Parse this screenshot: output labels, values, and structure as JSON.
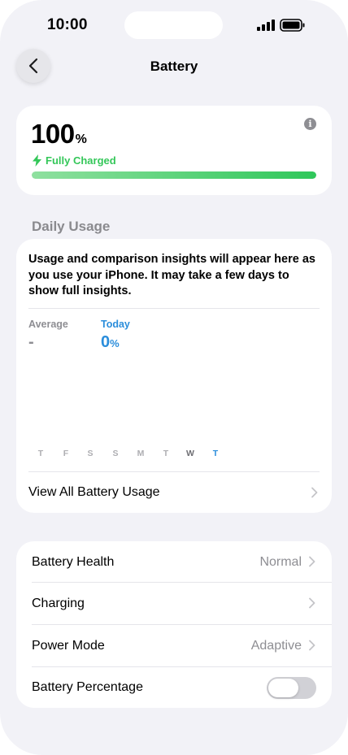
{
  "status_bar": {
    "time": "10:00"
  },
  "nav": {
    "title": "Battery"
  },
  "battery_level": {
    "percent": "100",
    "unit": "%",
    "state": "Fully Charged",
    "fill_fraction": 1.0
  },
  "daily_usage": {
    "header": "Daily Usage",
    "message": "Usage and comparison insights will appear here as you use your iPhone. It may take a few days to show full insights.",
    "average_label": "Average",
    "average_value": "-",
    "today_label": "Today",
    "today_value": "0",
    "today_unit": "%",
    "days": [
      "T",
      "F",
      "S",
      "S",
      "M",
      "T",
      "W",
      "T"
    ],
    "view_all_label": "View All Battery Usage"
  },
  "settings": {
    "rows": [
      {
        "label": "Battery Health",
        "value": "Normal"
      },
      {
        "label": "Charging",
        "value": ""
      },
      {
        "label": "Power Mode",
        "value": "Adaptive"
      },
      {
        "label": "Battery Percentage",
        "value": ""
      }
    ],
    "battery_percentage_enabled": false
  },
  "colors": {
    "accent_blue": "#2a8ddb",
    "charge_green": "#34c759",
    "background": "#f2f2f7"
  }
}
